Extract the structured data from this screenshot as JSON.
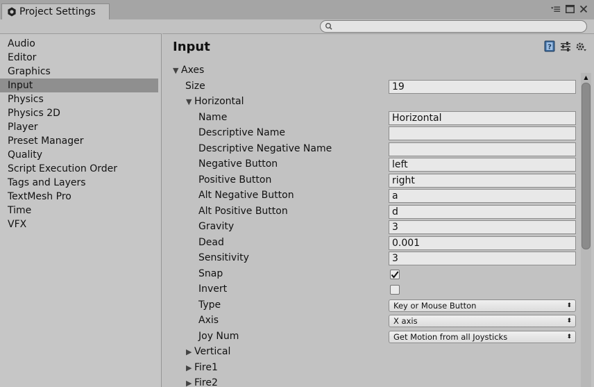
{
  "window": {
    "tab_title": "Project Settings"
  },
  "search": {
    "value": "",
    "placeholder": ""
  },
  "sidebar": {
    "items": [
      {
        "label": "Audio"
      },
      {
        "label": "Editor"
      },
      {
        "label": "Graphics"
      },
      {
        "label": "Input",
        "selected": true
      },
      {
        "label": "Physics"
      },
      {
        "label": "Physics 2D"
      },
      {
        "label": "Player"
      },
      {
        "label": "Preset Manager"
      },
      {
        "label": "Quality"
      },
      {
        "label": "Script Execution Order"
      },
      {
        "label": "Tags and Layers"
      },
      {
        "label": "TextMesh Pro"
      },
      {
        "label": "Time"
      },
      {
        "label": "VFX"
      }
    ]
  },
  "main": {
    "title": "Input",
    "axes_label": "Axes",
    "size_label": "Size",
    "size_value": "19",
    "horizontal": {
      "label": "Horizontal",
      "fields": [
        {
          "label": "Name",
          "value": "Horizontal"
        },
        {
          "label": "Descriptive Name",
          "value": ""
        },
        {
          "label": "Descriptive Negative Name",
          "value": ""
        },
        {
          "label": "Negative Button",
          "value": "left"
        },
        {
          "label": "Positive Button",
          "value": "right"
        },
        {
          "label": "Alt Negative Button",
          "value": "a"
        },
        {
          "label": "Alt Positive Button",
          "value": "d"
        },
        {
          "label": "Gravity",
          "value": "3"
        },
        {
          "label": "Dead",
          "value": "0.001"
        },
        {
          "label": "Sensitivity",
          "value": "3"
        }
      ],
      "snap_label": "Snap",
      "snap_checked": true,
      "invert_label": "Invert",
      "invert_checked": false,
      "type_label": "Type",
      "type_value": "Key or Mouse Button",
      "axis_label": "Axis",
      "axis_value": "X axis",
      "joy_label": "Joy Num",
      "joy_value": "Get Motion from all Joysticks"
    },
    "collapsed": [
      {
        "label": "Vertical"
      },
      {
        "label": "Fire1"
      },
      {
        "label": "Fire2"
      }
    ]
  },
  "icons": {
    "tab": "unity-gear-icon",
    "help": "help-book-icon",
    "presets": "presets-sliders-icon",
    "settings": "settings-gear-icon"
  }
}
